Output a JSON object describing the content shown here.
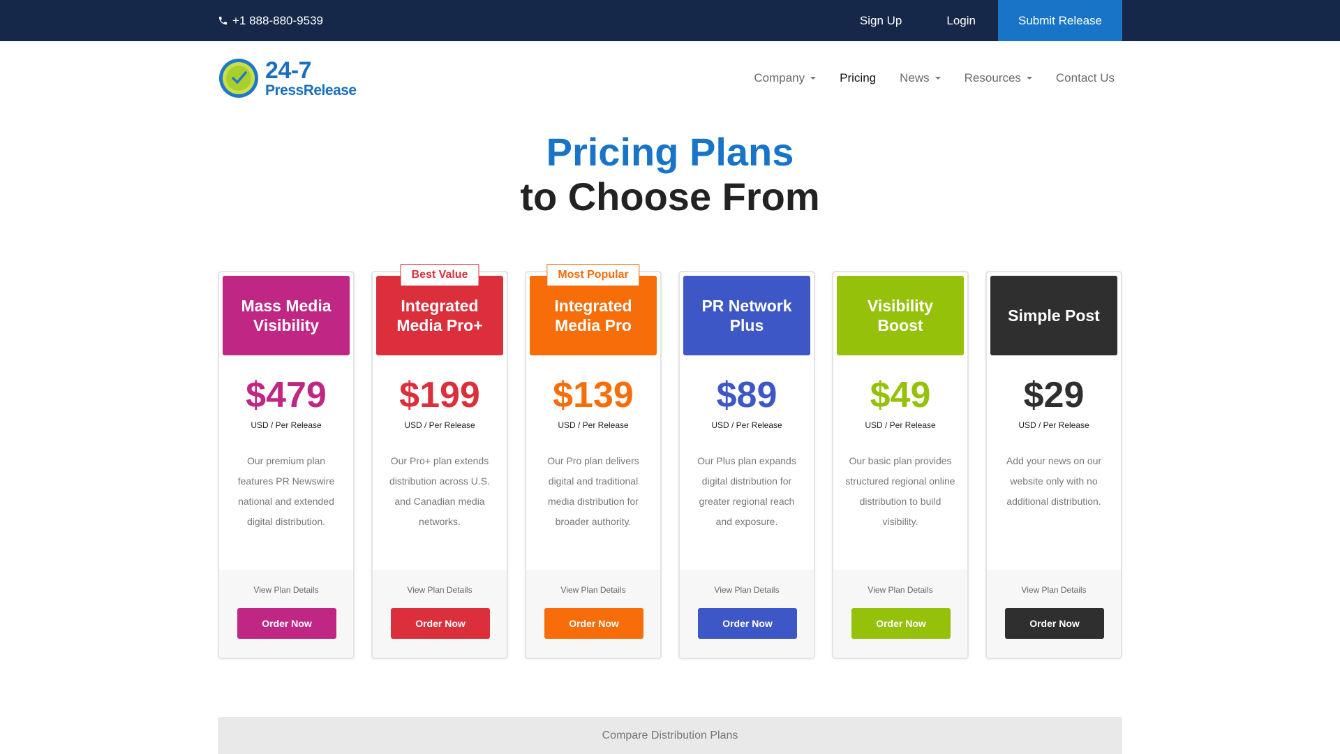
{
  "topbar": {
    "phone": "+1 888-880-9539",
    "sign_up": "Sign Up",
    "login": "Login",
    "submit": "Submit Release"
  },
  "logo": {
    "line1": "24-7",
    "line2": "PressRelease"
  },
  "nav": {
    "company": "Company",
    "pricing": "Pricing",
    "news": "News",
    "resources": "Resources",
    "contact": "Contact Us"
  },
  "hero": {
    "line1": "Pricing Plans",
    "line2": "to Choose From"
  },
  "plans": [
    {
      "name": "Mass Media Visibility",
      "color": "#c02785",
      "price": "$479",
      "per": "USD / Per Release",
      "desc": "Our premium plan features PR Newswire national and extended digital distribution.",
      "details": "View Plan Details",
      "order": "Order Now",
      "ribbon": ""
    },
    {
      "name": "Integrated Media Pro+",
      "color": "#dc2f3c",
      "price": "$199",
      "per": "USD / Per Release",
      "desc": "Our Pro+ plan extends distribution across U.S. and Canadian media networks.",
      "details": "View Plan Details",
      "order": "Order Now",
      "ribbon": "Best Value"
    },
    {
      "name": "Integrated Media Pro",
      "color": "#f66d0a",
      "price": "$139",
      "per": "USD / Per Release",
      "desc": "Our Pro plan delivers digital and traditional media distribution for broader authority.",
      "details": "View Plan Details",
      "order": "Order Now",
      "ribbon": "Most Popular"
    },
    {
      "name": "PR Network Plus",
      "color": "#3d57c6",
      "price": "$89",
      "per": "USD / Per Release",
      "desc": "Our Plus plan expands digital distribution for greater regional reach and exposure.",
      "details": "View Plan Details",
      "order": "Order Now",
      "ribbon": ""
    },
    {
      "name": "Visibility Boost",
      "color": "#96c10b",
      "price": "$49",
      "per": "USD / Per Release",
      "desc": "Our basic plan provides structured regional online distribution to build visibility.",
      "details": "View Plan Details",
      "order": "Order Now",
      "ribbon": ""
    },
    {
      "name": "Simple Post",
      "color": "#2f2f2f",
      "price": "$29",
      "per": "USD / Per Release",
      "desc": "Add your news on our website only with no additional distribution.",
      "details": "View Plan Details",
      "order": "Order Now",
      "ribbon": ""
    }
  ],
  "compare": "Compare Distribution Plans",
  "icons": {
    "phone": "phone-icon",
    "logo": "clock-logo-icon",
    "caret": "caret-down-icon"
  }
}
